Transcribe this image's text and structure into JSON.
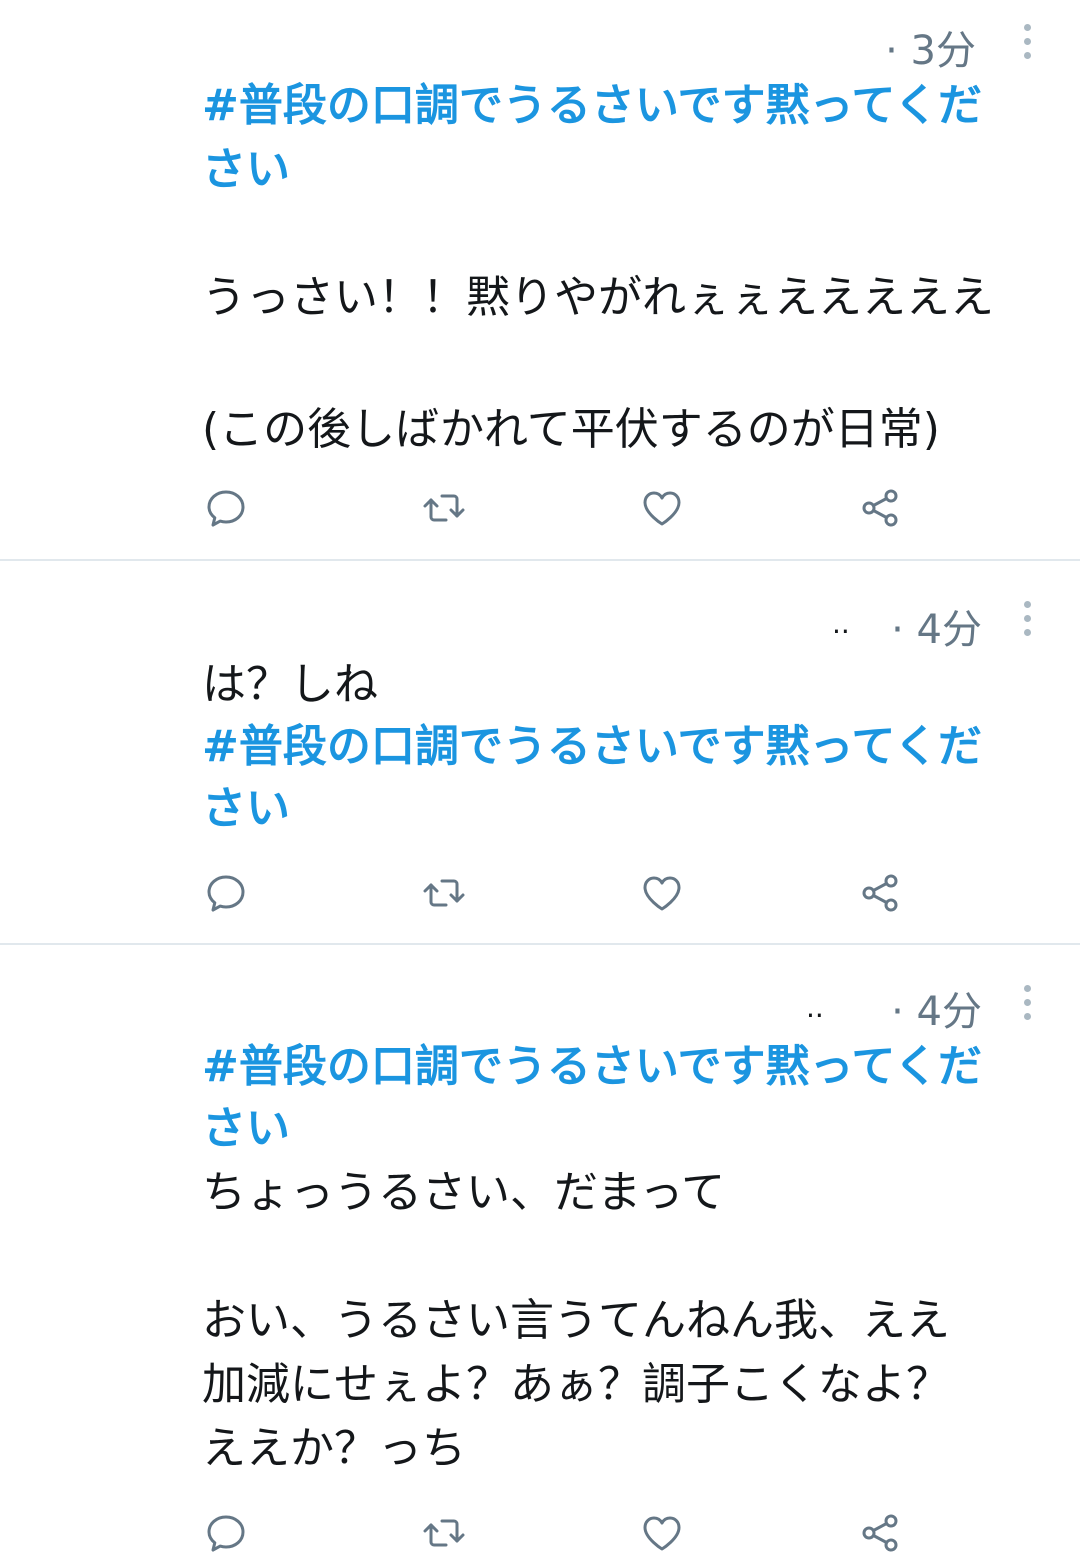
{
  "tweets": [
    {
      "time": "· 3分",
      "handle_fragment": "",
      "lines": [
        "#普段の口調でうるさいです黙ってくだ",
        "さい",
        "",
        "うっさい！！黙りやがれぇぇえええええ",
        "",
        "(この後しばかれて平伏するのが日常)"
      ]
    },
    {
      "time": "· 4分",
      "handle_fragment": "..",
      "lines": [
        "は？しね",
        "#普段の口調でうるさいです黙ってくだ",
        "さい"
      ]
    },
    {
      "time": "· 4分",
      "handle_fragment": "..",
      "lines": [
        "#普段の口調でうるさいです黙ってくだ",
        "さい",
        "ちょっうるさい、だまって",
        "",
        "おい、うるさい言うてんねん我、ええ",
        "加減にせぇよ？あぁ？調子こくなよ？",
        "ええか？っち"
      ]
    }
  ],
  "icons": {
    "reply": "reply-icon",
    "retweet": "retweet-icon",
    "like": "heart-icon",
    "share": "share-icon",
    "more": "more-vertical-icon"
  },
  "colors": {
    "hashtag": "#1b95e0",
    "text": "#14171a",
    "secondary": "#657786",
    "divider": "#e1e8ed"
  }
}
